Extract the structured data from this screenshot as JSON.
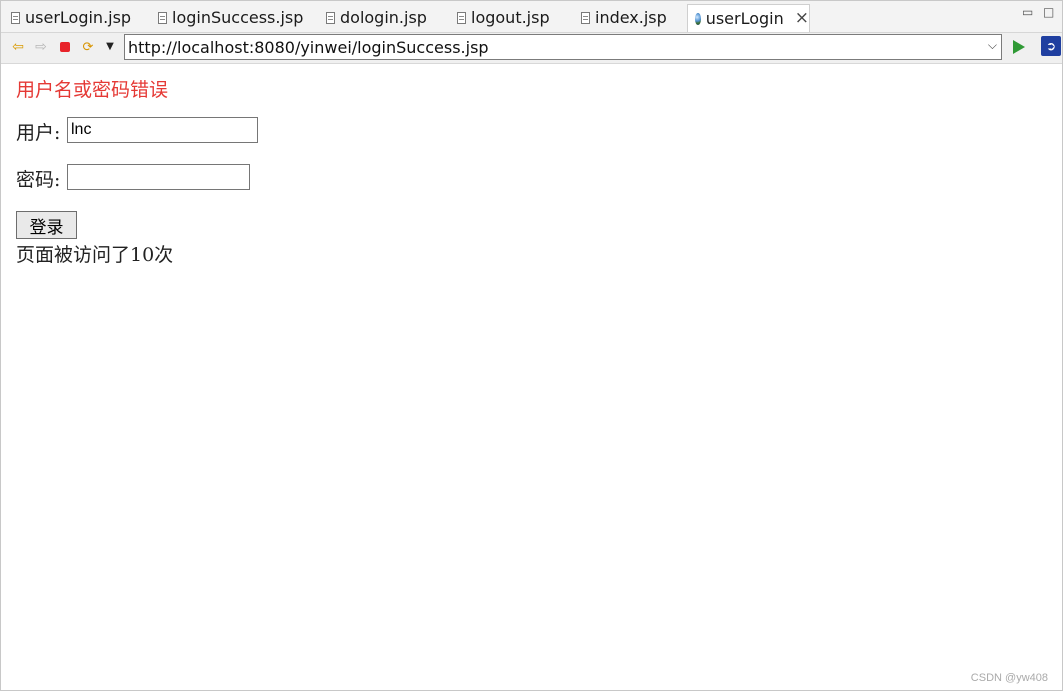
{
  "tabs": [
    {
      "label": "userLogin.jsp",
      "icon": "jsp-file-icon"
    },
    {
      "label": "loginSuccess.jsp",
      "icon": "jsp-file-icon"
    },
    {
      "label": "dologin.jsp",
      "icon": "jsp-file-icon"
    },
    {
      "label": "logout.jsp",
      "icon": "jsp-file-icon"
    },
    {
      "label": "index.jsp",
      "icon": "jsp-file-icon"
    },
    {
      "label": "userLogin",
      "icon": "globe-icon",
      "active": true
    }
  ],
  "toolbar": {
    "url": "http://localhost:8080/yinwei/loginSuccess.jsp"
  },
  "page": {
    "error_message": "用户名或密码错误",
    "username_label": "用户:",
    "username_value": "lnc",
    "password_label": "密码:",
    "password_value": "",
    "login_button": "登录",
    "visit_text": "页面被访问了10次"
  },
  "watermark": "CSDN @yw408",
  "colors": {
    "error": "#e53935",
    "go": "#2f9a35"
  }
}
